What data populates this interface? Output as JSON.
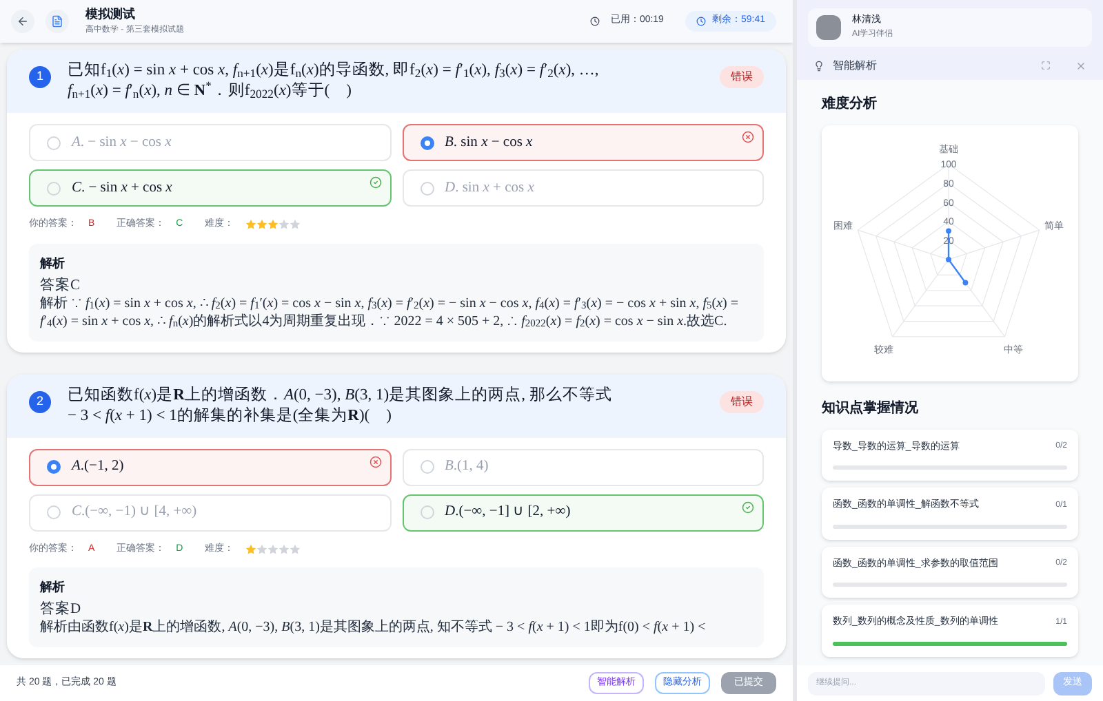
{
  "header": {
    "title": "模拟测试",
    "subtitle": "高中数学 - 第三套模拟试题",
    "elapsed": "已用：00:19",
    "remaining": "剩余：59:41"
  },
  "questions": [
    {
      "number": "1",
      "status": "错误",
      "text": "已知f$_{1}$(*x*) = sin *x* + cos *x*, *f*$_{n+1}$(*x*)是f$_{n}$(*x*)的导函数, 即f$_{2}$(*x*) = *f*′$_{1}$(*x*), *f*$_{3}$(*x*) = *f*′$_{2}$(*x*), …, *f*$_{n+1}$(*x*) = *f*′$_{n}$(*x*), *n* ∈ **N**$^{*}$．则f$_{2022}$(*x*)等于(　)",
      "options": [
        {
          "text": "*A*. − sin *x* − cos *x*",
          "kind": "normal",
          "selected": false
        },
        {
          "text": "*B*. sin *x* − cos *x*",
          "kind": "wrong",
          "selected": true
        },
        {
          "text": "*C*. − sin *x* + cos *x*",
          "kind": "correct",
          "selected": false
        },
        {
          "text": "*D*. sin *x* + cos *x*",
          "kind": "normal",
          "selected": false
        }
      ],
      "your_answer_label": "你的答案：",
      "your_answer": "B",
      "correct_label": "正确答案：",
      "correct_answer": "C",
      "difficulty_label": "难度：",
      "stars": 3,
      "analysis_title": "解析",
      "answer": "答案C",
      "analysis": "解析 ∵ *f*$_{1}$(*x*) = sin *x* + cos *x*, ∴ *f*$_{2}$(*x*) = *f*$_{1}$′(*x*) = cos *x* − sin *x*, *f*$_{3}$(*x*) = *f*′$_{2}$(*x*) = − sin *x* − cos *x*, *f*$_{4}$(*x*) = *f*′$_{3}$(*x*) = − cos *x* + sin *x*, *f*$_{5}$(*x*) = *f*′$_{4}$(*x*) = sin *x* + cos *x*, ∴ *f*$_{n}$(*x*)的解析式以4为周期重复出现．∵ 2022 = 4 × 505 + 2, ∴ *f*$_{2022}$(*x*) = *f*$_{2}$(*x*) = cos *x* − sin *x*.故选C."
    },
    {
      "number": "2",
      "status": "错误",
      "text": "已知函数f(*x*)是**R**上的增函数．*A*(0, −3), *B*(3, 1)是其图象上的两点, 那么不等式 − 3 < *f*(*x* + 1) < 1的解集的补集是(全集为**R**)(　)",
      "options": [
        {
          "text": "*A*.(−1, 2)",
          "kind": "wrong",
          "selected": true
        },
        {
          "text": "*B*.(1, 4)",
          "kind": "normal",
          "selected": false
        },
        {
          "text": "*C*.(−∞, −1) ∪ [4, +∞)",
          "kind": "normal",
          "selected": false
        },
        {
          "text": "*D*.(−∞, −1] ∪ [2, +∞)",
          "kind": "correct",
          "selected": false
        }
      ],
      "your_answer_label": "你的答案：",
      "your_answer": "A",
      "correct_label": "正确答案：",
      "correct_answer": "D",
      "difficulty_label": "难度：",
      "stars": 1,
      "analysis_title": "解析",
      "answer": "答案D",
      "analysis": "解析由函数f(*x*)是**R**上的增函数, *A*(0, −3), *B*(3, 1)是其图象上的两点, 知不等式 − 3 < *f*(*x* + 1) < 1即为f(0) < *f*(*x* + 1) <"
    }
  ],
  "footer": {
    "summary": "共 20 题，已完成 20 题",
    "buttons": [
      {
        "label": "智能解析",
        "kind": "purple"
      },
      {
        "label": "隐藏分析",
        "kind": "blue"
      },
      {
        "label": "已提交",
        "kind": "disabled"
      }
    ]
  },
  "assistant": {
    "name": "林清浅",
    "role": "AI学习伴侣",
    "panel_title": "智能解析"
  },
  "difficulty": {
    "title": "难度分析",
    "axis_labels": [
      "基础",
      "简单",
      "中等",
      "较难",
      "困难"
    ],
    "tick_labels": [
      "100",
      "80",
      "60",
      "40",
      "20"
    ]
  },
  "knowledge": {
    "title": "知识点掌握情况",
    "items": [
      {
        "name": "导数_导数的运算_导数的运算",
        "count": "0/2",
        "level": 0
      },
      {
        "name": "函数_函数的单调性_解函数不等式",
        "count": "0/1",
        "level": 0
      },
      {
        "name": "函数_函数的单调性_求参数的取值范围",
        "count": "0/2",
        "level": 0
      },
      {
        "name": "数列_数列的概念及性质_数列的单调性",
        "count": "1/1",
        "level": 1
      }
    ]
  },
  "chat": {
    "placeholder": "继续提问...",
    "send": "发送"
  }
}
